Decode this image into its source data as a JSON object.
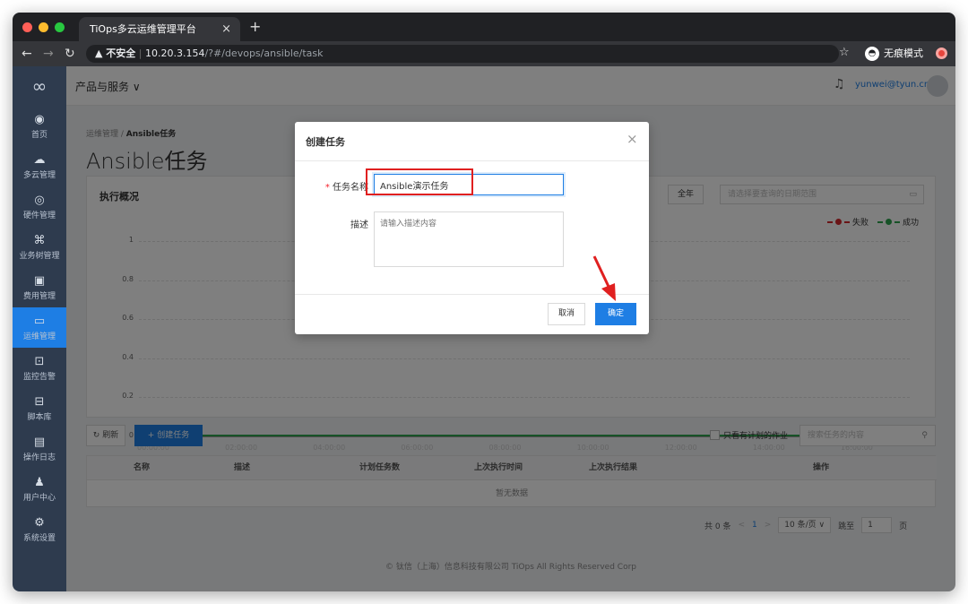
{
  "browser": {
    "tab_title": "TiOps多云运维管理平台",
    "tab_close": "×",
    "new_tab": "+",
    "security_label": "▲ 不安全",
    "url_host": "10.20.3.154",
    "url_path": "/?#/devops/ansible/task",
    "incognito_label": "无痕模式"
  },
  "header": {
    "products_label": "产品与服务 ∨",
    "username": "yunwei@tyun.cn"
  },
  "sidebar": {
    "items": [
      {
        "icon": "◉",
        "label": "首页"
      },
      {
        "icon": "☁",
        "label": "多云管理"
      },
      {
        "icon": "◎",
        "label": "硬件管理"
      },
      {
        "icon": "⌘",
        "label": "业务树管理"
      },
      {
        "icon": "▣",
        "label": "费用管理"
      },
      {
        "icon": "▭",
        "label": "运维管理"
      },
      {
        "icon": "⊡",
        "label": "监控告警"
      },
      {
        "icon": "⊟",
        "label": "脚本库"
      },
      {
        "icon": "▤",
        "label": "操作日志"
      },
      {
        "icon": "♟",
        "label": "用户中心"
      },
      {
        "icon": "⚙",
        "label": "系统设置"
      }
    ],
    "active_index": 5
  },
  "breadcrumb": {
    "parent": "运维管理",
    "sep": " / ",
    "current": "Ansible任务"
  },
  "page_title": "Ansible任务",
  "overview": {
    "title": "执行概况",
    "year_button": "全年",
    "date_placeholder": "请选择要查询的日期范围"
  },
  "chart_data": {
    "type": "line",
    "x": [
      "00:00:00",
      "02:00:00",
      "04:00:00",
      "06:00:00",
      "08:00:00",
      "10:00:00",
      "12:00:00",
      "14:00:00",
      "16:00:00"
    ],
    "yticks": [
      "1",
      "0.8",
      "0.6",
      "0.4",
      "0.2",
      "0"
    ],
    "ylim": [
      0,
      1
    ],
    "series": [
      {
        "name": "失败",
        "color": "#d4282d",
        "values": [
          0,
          0,
          0,
          0,
          0,
          0,
          0,
          0,
          0
        ]
      },
      {
        "name": "成功",
        "color": "#2ea44f",
        "values": [
          0,
          0,
          0,
          0,
          0,
          0,
          0,
          0,
          0
        ]
      }
    ],
    "legend": "top-right",
    "grid": true
  },
  "toolbar": {
    "refresh_label": "刷新",
    "create_label": "+ 创建任务",
    "only_scheduled_label": "只看有计划的作业",
    "search_placeholder": "搜索任务的内容"
  },
  "table": {
    "columns": [
      "名称",
      "描述",
      "计划任务数",
      "上次执行时间",
      "上次执行结果",
      "操作"
    ],
    "empty_text": "暂无数据"
  },
  "pager": {
    "total": "共 0 条",
    "prev": "<",
    "current": "1",
    "next": ">",
    "page_size": "10 条/页 ∨",
    "jump_label": "跳至",
    "jump_value": "1",
    "page_unit": "页"
  },
  "footer": "© 钛信（上海）信息科技有限公司 TiOps All Rights Reserved Corp",
  "modal": {
    "title": "创建任务",
    "close": "×",
    "name_label": "任务名称",
    "name_value": "Ansible演示任务",
    "desc_label": "描述",
    "desc_placeholder": "请输入描述内容",
    "cancel_label": "取消",
    "ok_label": "确定"
  },
  "colors": {
    "primary": "#1e7ee4",
    "sidebar": "#2e3b4e",
    "annotation": "#e02020"
  }
}
